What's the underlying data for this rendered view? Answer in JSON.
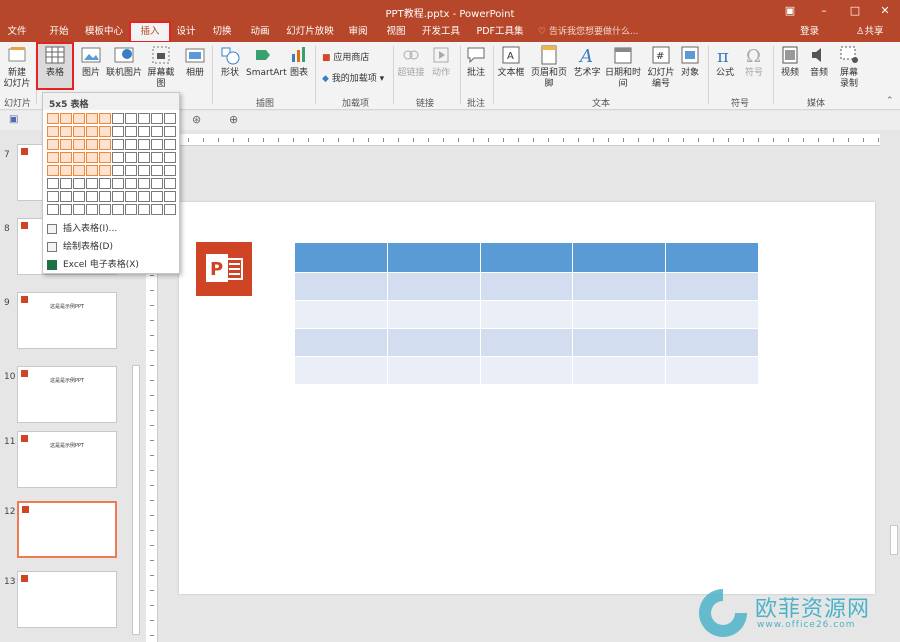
{
  "window": {
    "title": "PPT教程.pptx - PowerPoint"
  },
  "tabs": [
    {
      "label": "文件"
    },
    {
      "label": "开始"
    },
    {
      "label": "模板中心"
    },
    {
      "label": "插入"
    },
    {
      "label": "设计"
    },
    {
      "label": "切换"
    },
    {
      "label": "动画"
    },
    {
      "label": "幻灯片放映"
    },
    {
      "label": "审阅"
    },
    {
      "label": "视图"
    },
    {
      "label": "开发工具"
    },
    {
      "label": "PDF工具集"
    }
  ],
  "active_tab": "插入",
  "tellme": "告诉我您想要做什么...",
  "account": {
    "login": "登录",
    "share": "共享"
  },
  "ribbon": {
    "new_slide": "新建\n幻灯片",
    "table": "表格",
    "picture": "图片",
    "online_picture": "联机图片",
    "screenshot": "屏幕截图",
    "album": "相册",
    "shapes": "形状",
    "smartart": "SmartArt",
    "chart": "图表",
    "store": "应用商店",
    "my_addins": "我的加载项",
    "hyperlink": "超链接",
    "action": "动作",
    "comment": "批注",
    "textbox": "文本框",
    "header_footer": "页眉和页脚",
    "wordart": "艺术字",
    "datetime": "日期和时间",
    "slide_number": "幻灯片\n编号",
    "object": "对象",
    "equation": "公式",
    "symbol": "符号",
    "video": "视频",
    "audio": "音频",
    "screen_record": "屏幕\n录制"
  },
  "groups": {
    "slides": "幻灯片",
    "images": "插图",
    "addins": "加载项",
    "links": "链接",
    "comments": "批注",
    "text": "文本",
    "symbols": "符号",
    "media": "媒体"
  },
  "table_dropdown": {
    "header": "5x5 表格",
    "insert_table": "插入表格(I)...",
    "draw_table": "绘制表格(D)",
    "excel_table": "Excel 电子表格(X)",
    "grid_cols": 10,
    "grid_rows": 8,
    "selected_cols": 5,
    "selected_rows": 5
  },
  "thumbnails": [
    {
      "num": "7",
      "text": ""
    },
    {
      "num": "8",
      "text": ""
    },
    {
      "num": "9",
      "text": "这是是示例PPT"
    },
    {
      "num": "10",
      "text": "这是是示例PPT"
    },
    {
      "num": "11",
      "text": "这是是示例PPT"
    },
    {
      "num": "12",
      "text": ""
    },
    {
      "num": "13",
      "text": ""
    }
  ],
  "watermark": {
    "text": "欧菲资源网",
    "url": "www.office26.com"
  },
  "colors": {
    "accent": "#b7472a",
    "table_header": "#5b9bd5",
    "table_odd": "#d2deef",
    "table_even": "#eaeff7",
    "highlight": "#e52225"
  }
}
